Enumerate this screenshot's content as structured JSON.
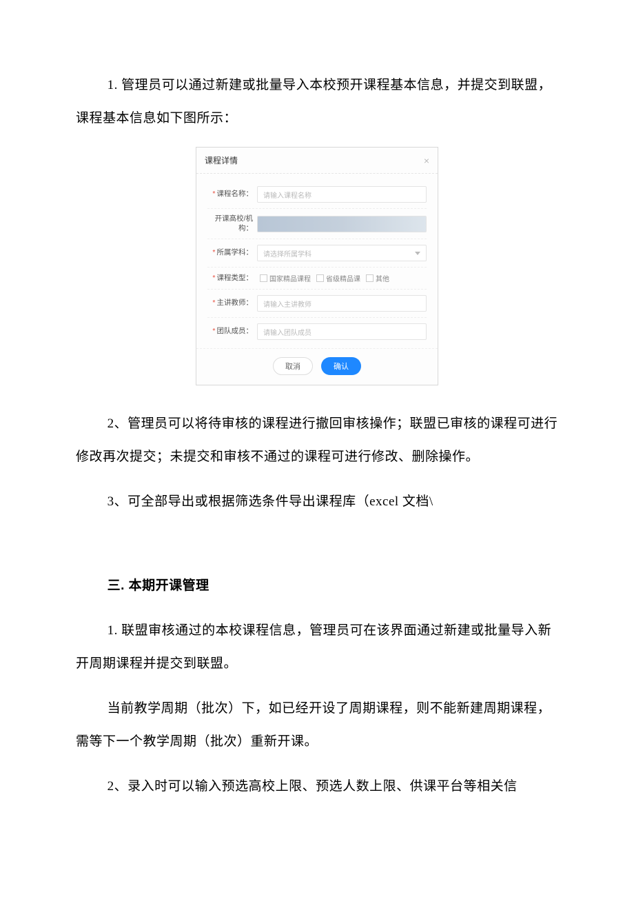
{
  "paragraphs": {
    "p1": "1. 管理员可以通过新建或批量导入本校预开课程基本信息，并提交到联盟，课程基本信息如下图所示：",
    "p2": "2、管理员可以将待审核的课程进行撤回审核操作；联盟已审核的课程可进行修改再次提交；未提交和审核不通过的课程可进行修改、删除操作。",
    "p3": "3、可全部导出或根据筛选条件导出课程库（excel 文档\\",
    "h3": "三. 本期开课管理",
    "p4": "1. 联盟审核通过的本校课程信息，管理员可在该界面通过新建或批量导入新开周期课程并提交到联盟。",
    "p5": "当前教学周期（批次）下，如已经开设了周期课程，则不能新建周期课程，需等下一个教学周期（批次）重新开课。",
    "p6": "2、录入时可以输入预选高校上限、预选人数上限、供课平台等相关信"
  },
  "modal": {
    "title": "课程详情",
    "close": "×",
    "fields": {
      "courseName": {
        "label": "课程名称：",
        "placeholder": "请输入课程名称",
        "required": true
      },
      "openSchool": {
        "label": "开课高校/机构：",
        "required": false
      },
      "subject": {
        "label": "所属学科：",
        "placeholder": "请选择所属学科",
        "required": true
      },
      "courseType": {
        "label": "课程类型：",
        "required": true,
        "options": {
          "opt1": "国家精品课程",
          "opt2": "省级精品课",
          "opt3": "其他"
        }
      },
      "teacher": {
        "label": "主讲教师：",
        "placeholder": "请输入主讲教师",
        "required": true
      },
      "team": {
        "label": "团队成员：",
        "placeholder": "请输入团队成员",
        "required": true
      }
    },
    "buttons": {
      "cancel": "取消",
      "ok": "确认"
    }
  }
}
